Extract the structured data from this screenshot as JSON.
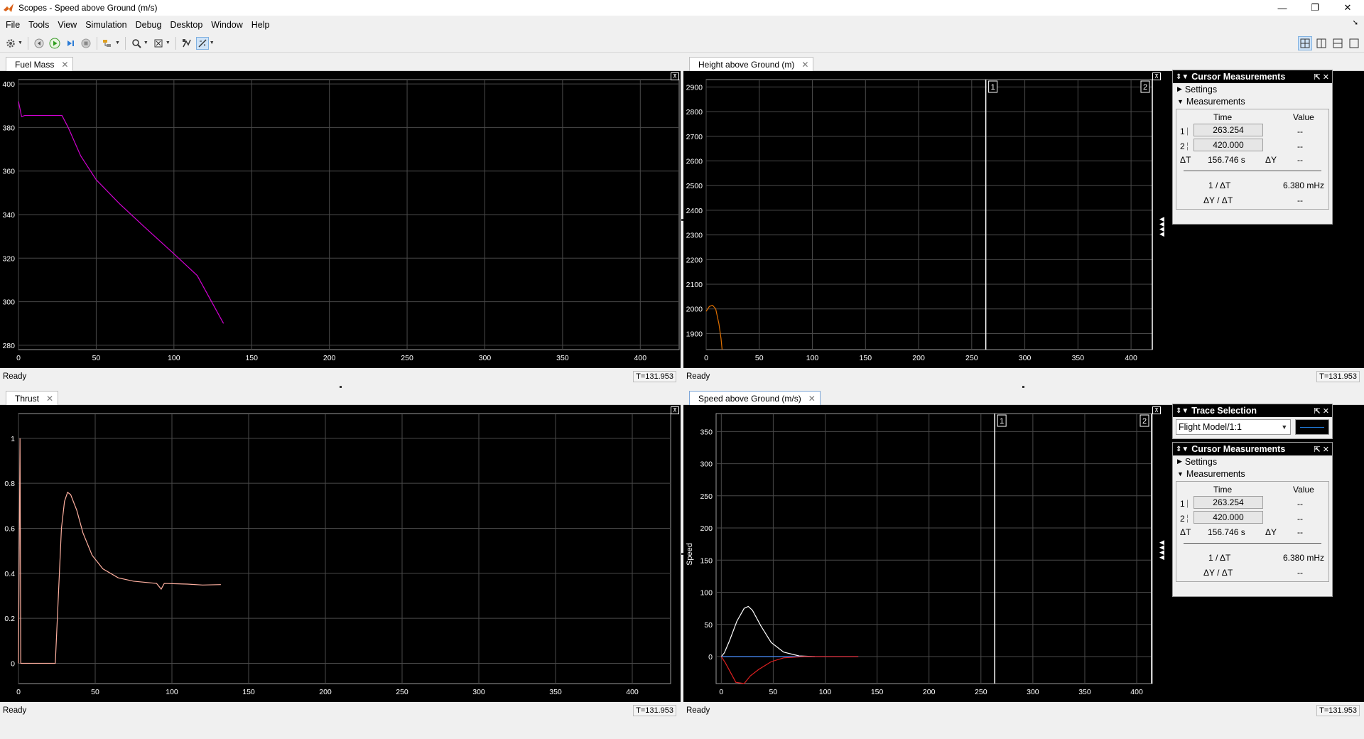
{
  "window": {
    "title": "Scopes - Speed above Ground (m/s)",
    "buttons": [
      "—",
      "❐",
      "✕"
    ]
  },
  "menu": [
    "File",
    "Tools",
    "View",
    "Simulation",
    "Debug",
    "Desktop",
    "Window",
    "Help"
  ],
  "toolbar_icons": [
    "gear-icon",
    "step-back-icon",
    "run-icon",
    "step-forward-icon",
    "stop-icon",
    "highlight-icon",
    "zoom-icon",
    "autoscale-icon",
    "write-data-icon",
    "cursor-measure-icon"
  ],
  "layout_icons": [
    "tile-2x2-icon",
    "tile-vertical-icon",
    "tile-horizontal-icon",
    "single-icon"
  ],
  "status": {
    "ready": "Ready",
    "time": "T=131.953"
  },
  "scopes": {
    "fuel": {
      "tab": "Fuel Mass",
      "yticks": [
        "400",
        "380",
        "360",
        "340",
        "320",
        "300",
        "280"
      ],
      "xticks": [
        "0",
        "50",
        "100",
        "150",
        "200",
        "250",
        "300",
        "350",
        "400"
      ]
    },
    "height": {
      "tab": "Height above Ground (m)",
      "yticks": [
        "2900",
        "2800",
        "2700",
        "2600",
        "2500",
        "2400",
        "2300",
        "2200",
        "2100",
        "2000",
        "1900"
      ],
      "xticks": [
        "0",
        "50",
        "100",
        "150",
        "200",
        "250",
        "300",
        "350",
        "400"
      ],
      "cursor1": "1",
      "cursor2": "2"
    },
    "thrust": {
      "tab": "Thrust",
      "yticks": [
        "1",
        "0.8",
        "0.6",
        "0.4",
        "0.2",
        "0"
      ],
      "xticks": [
        "0",
        "50",
        "100",
        "150",
        "200",
        "250",
        "300",
        "350",
        "400"
      ]
    },
    "speed": {
      "tab": "Speed above Ground (m/s)",
      "ylabel": "Speed",
      "yticks": [
        "350",
        "300",
        "250",
        "200",
        "150",
        "100",
        "50",
        "0"
      ],
      "xticks": [
        "0",
        "50",
        "100",
        "150",
        "200",
        "250",
        "300",
        "350",
        "400"
      ],
      "cursor1": "1",
      "cursor2": "2"
    }
  },
  "cursor_panel": {
    "title": "Cursor Measurements",
    "settings": "Settings",
    "measurements": "Measurements",
    "col_time": "Time",
    "col_value": "Value",
    "row1_label": "1",
    "row1_time": "263.254",
    "row1_value": "--",
    "row2_label": "2",
    "row2_time": "420.000",
    "row2_value": "--",
    "dt_label": "ΔT",
    "dt_value": "156.746 s",
    "dy_label": "ΔY",
    "dy_value": "--",
    "inv_dt_label": "1 / ΔT",
    "inv_dt_value": "6.380 mHz",
    "dy_dt_label": "ΔY / ΔT",
    "dy_dt_value": "--"
  },
  "trace_panel": {
    "title": "Trace Selection",
    "selected": "Flight Model/1:1"
  },
  "colors": {
    "fuel_line": "#d000d0",
    "height_line": "#e07000",
    "thrust_line": "#ffb0a0",
    "speed_white": "#ffffff",
    "speed_blue": "#4a90ff",
    "speed_red": "#e02020",
    "grid": "#4a4a4a"
  }
}
